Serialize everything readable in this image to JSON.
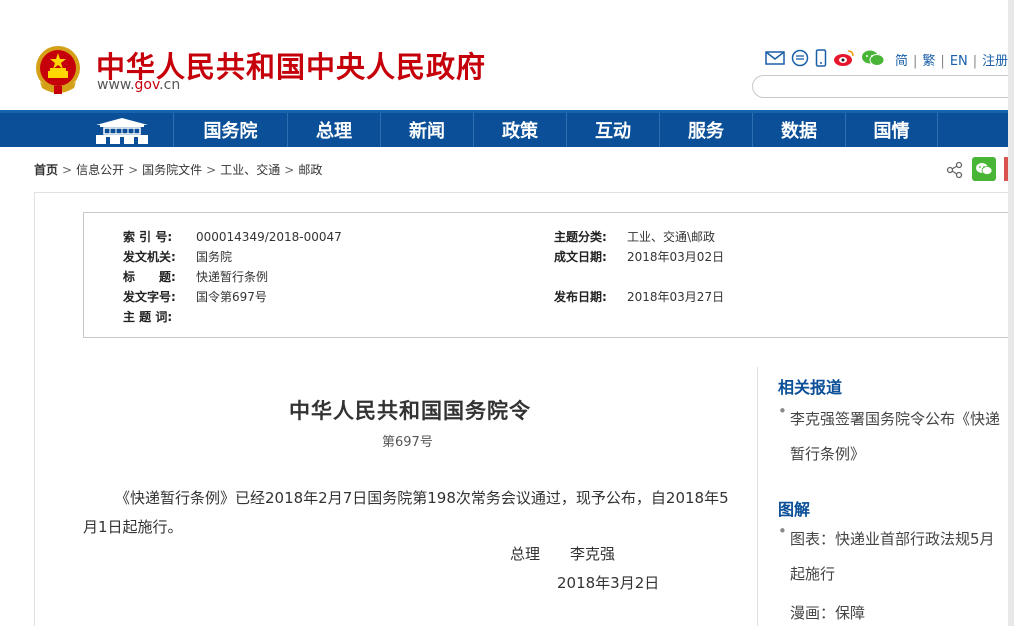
{
  "header": {
    "title": "中华人民共和国中央人民政府",
    "url_prefix": "www.",
    "url_gov": "gov",
    "url_suffix": ".cn",
    "lang_links": [
      "简",
      "繁",
      "EN",
      "注册"
    ],
    "icons": [
      "mail-icon",
      "message-icon",
      "mobile-icon",
      "weibo-icon",
      "wechat-icon"
    ]
  },
  "nav": {
    "items": [
      "国务院",
      "总理",
      "新闻",
      "政策",
      "互动",
      "服务",
      "数据",
      "国情"
    ]
  },
  "breadcrumb": {
    "items": [
      "首页",
      "信息公开",
      "国务院文件",
      "工业、交通",
      "邮政"
    ]
  },
  "info": {
    "index_label": "索 引 号:",
    "index_value": "000014349/2018-00047",
    "topic_label": "主题分类:",
    "topic_value": "工业、交通\\邮政",
    "issuer_label": "发文机关:",
    "issuer_value": "国务院",
    "created_label": "成文日期:",
    "created_value": "2018年03月02日",
    "title_label": "标　　题:",
    "title_value": "快递暂行条例",
    "docno_label": "发文字号:",
    "docno_value": "国令第697号",
    "published_label": "发布日期:",
    "published_value": "2018年03月27日",
    "keywords_label": "主 题 词:"
  },
  "article": {
    "title": "中华人民共和国国务院令",
    "number": "第697号",
    "paragraph": "《快递暂行条例》已经2018年2月7日国务院第198次常务会议通过，现予公布，自2018年5月1日起施行。",
    "signer_role": "总理",
    "signer_name": "李克强",
    "date": "2018年3月2日"
  },
  "sidebar": {
    "related_heading": "相关报道",
    "related_item": "李克强签署国务院令公布《快递暂行条例》",
    "graphic_heading": "图解",
    "graphic_item": "图表：快递业首部行政法规5月起施行",
    "comic_item": "漫画：保障"
  }
}
